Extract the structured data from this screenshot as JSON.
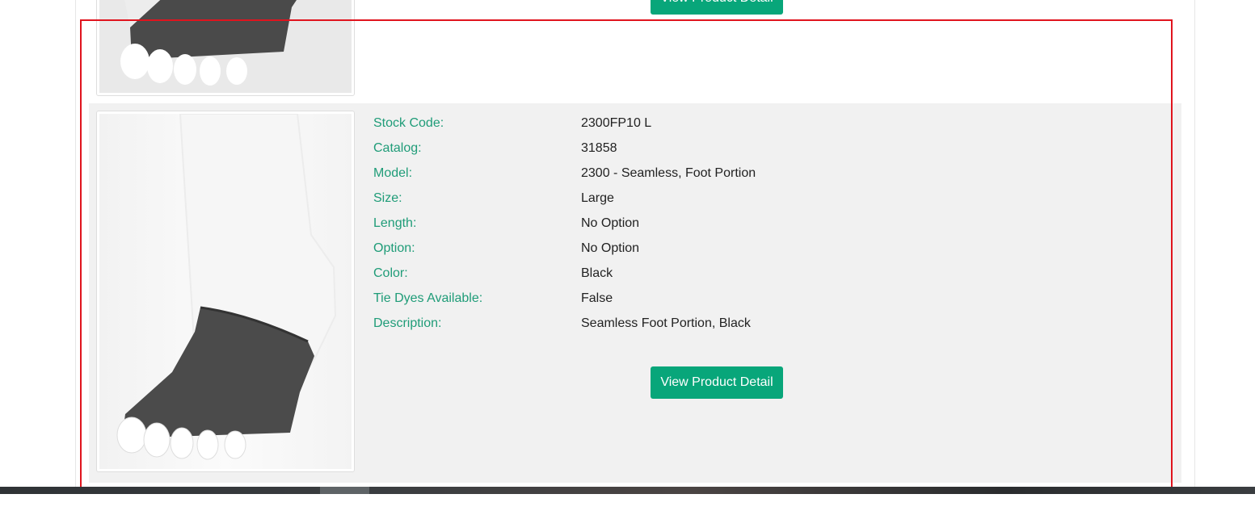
{
  "colors": {
    "label": "#1f9c78",
    "button": "#08a67a",
    "highlight_border": "#e0141e",
    "row_background": "#f1f1f1"
  },
  "products": [
    {
      "image_icon": "toe-sock-foot-portion-image",
      "button_label": "View Product Detail"
    },
    {
      "image_icon": "toe-sock-foot-portion-image",
      "details": [
        {
          "label": "Stock Code:",
          "value": "2300FP10 L"
        },
        {
          "label": "Catalog:",
          "value": "31858"
        },
        {
          "label": "Model:",
          "value": "2300 - Seamless, Foot Portion"
        },
        {
          "label": "Size:",
          "value": "Large"
        },
        {
          "label": "Length:",
          "value": "No Option"
        },
        {
          "label": "Option:",
          "value": "No Option"
        },
        {
          "label": "Color:",
          "value": "Black"
        },
        {
          "label": "Tie Dyes Available:",
          "value": "False"
        },
        {
          "label": "Description:",
          "value": "Seamless Foot Portion, Black"
        }
      ],
      "button_label": "View Product Detail"
    }
  ]
}
